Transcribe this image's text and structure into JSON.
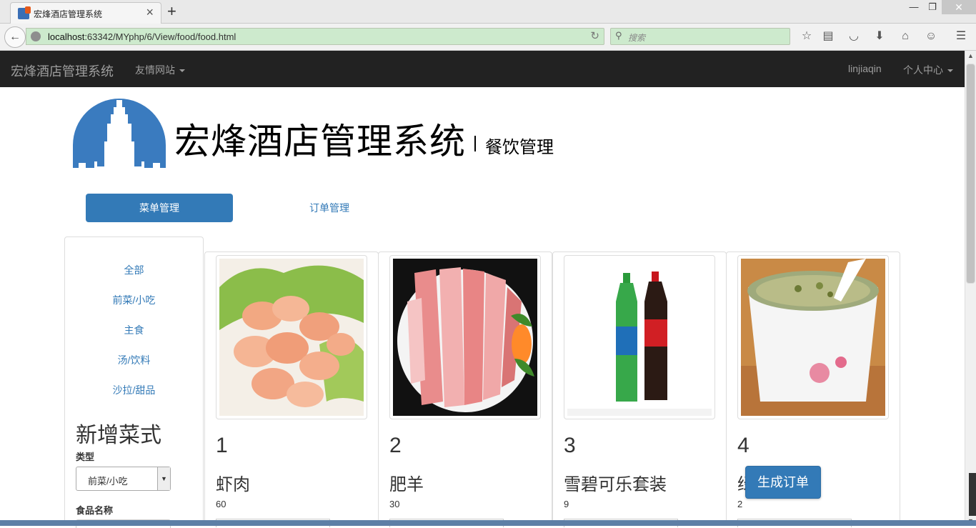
{
  "browser": {
    "tab_title": "宏烽酒店管理系统",
    "url_host": "localhost",
    "url_path": ":63342/MYphp/6/View/food/food.html",
    "search_placeholder": "搜索"
  },
  "navbar": {
    "brand": "宏烽酒店管理系统",
    "friend_sites": "友情网站",
    "username": "linjiaqin",
    "personal_center": "个人中心"
  },
  "header": {
    "title": "宏烽酒店管理系统",
    "subtitle": "餐饮管理"
  },
  "tabs": {
    "menu_mgmt": "菜单管理",
    "order_mgmt": "订单管理"
  },
  "sidebar": {
    "categories": [
      "全部",
      "前菜/小吃",
      "主食",
      "汤/饮料",
      "沙拉/甜品"
    ],
    "new_title": "新增菜式",
    "type_label": "类型",
    "type_value": "前菜/小吃",
    "name_label": "食品名称"
  },
  "foods": [
    {
      "id": "1",
      "name": "虾肉",
      "price": "60"
    },
    {
      "id": "2",
      "name": "肥羊",
      "price": "30"
    },
    {
      "id": "3",
      "name": "雪碧可乐套装",
      "price": "9"
    },
    {
      "id": "4",
      "name": "绿",
      "price": "2"
    }
  ],
  "actions": {
    "generate_order": "生成订单"
  },
  "colors": {
    "primary": "#337ab7",
    "navbar_bg": "#222222",
    "url_bg": "#cdeacd"
  }
}
